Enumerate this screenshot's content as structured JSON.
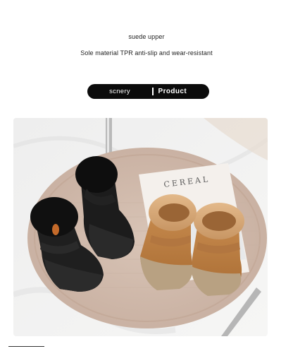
{
  "captions": {
    "line1": "suede upper",
    "line2": "Sole material TPR anti-slip and wear-resistant"
  },
  "tab_pill": {
    "left_label": "scnery",
    "right_label": "Product"
  },
  "photo": {
    "book_title": "CEREAL"
  }
}
